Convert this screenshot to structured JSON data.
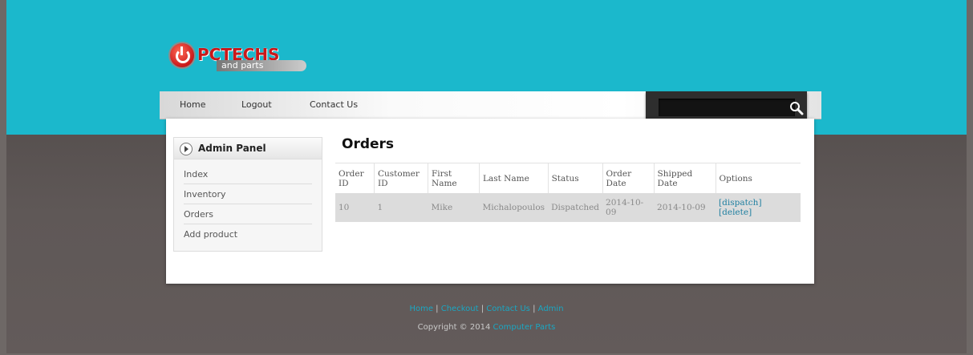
{
  "logo": {
    "name": "PCTECHS",
    "sub": "and parts"
  },
  "nav": {
    "items": [
      "Home",
      "Logout",
      "Contact Us"
    ]
  },
  "search": {
    "value": "",
    "placeholder": ""
  },
  "sidebar": {
    "title": "Admin Panel",
    "items": [
      "Index",
      "Inventory",
      "Orders",
      "Add product"
    ]
  },
  "main": {
    "title": "Orders",
    "columns": [
      "Order ID",
      "Customer ID",
      "First Name",
      "Last Name",
      "Status",
      "Order Date",
      "Shipped Date",
      "Options"
    ],
    "rows": [
      {
        "order_id": "10",
        "customer_id": "1",
        "first_name": "Mike",
        "last_name": "Michalopoulos",
        "status": "Dispatched",
        "order_date": "2014-10-09",
        "shipped_date": "2014-10-09",
        "actions": [
          "[dispatch]",
          "[delete]"
        ]
      }
    ]
  },
  "footer": {
    "links": [
      "Home",
      "Checkout",
      "Contact Us",
      "Admin"
    ],
    "separator": "|",
    "copyright_prefix": "Copyright © 2014",
    "brand": "Computer Parts"
  },
  "colors": {
    "header_band": "#1bb8cc",
    "link": "#1f7fa0",
    "brand_red": "#c9181a"
  }
}
